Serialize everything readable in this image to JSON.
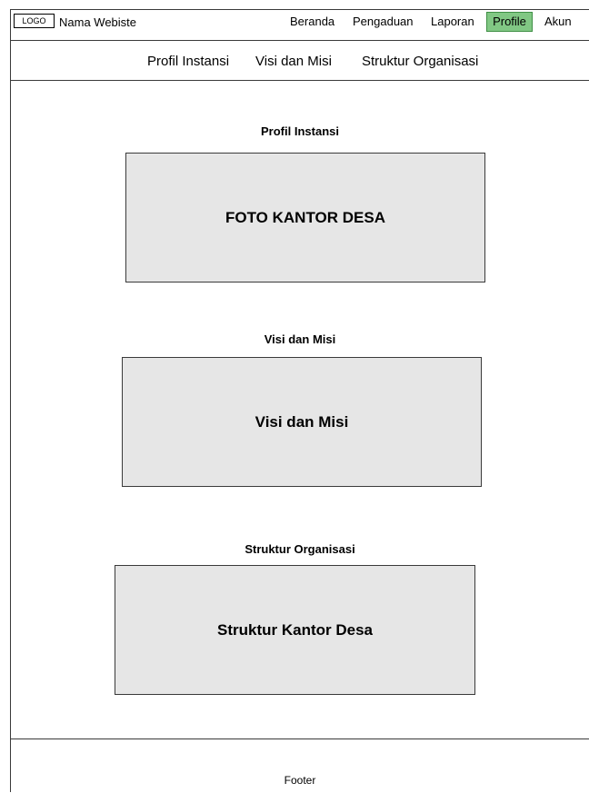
{
  "header": {
    "logo": "LOGO",
    "site_name": "Nama Webiste",
    "nav": {
      "beranda": "Beranda",
      "pengaduan": "Pengaduan",
      "laporan": "Laporan",
      "profile": "Profile",
      "akun": "Akun"
    },
    "active_nav": "Profile",
    "active_color": "#81c784"
  },
  "subnav": {
    "profil": "Profil Instansi",
    "visi": "Visi dan Misi",
    "struktur": "Struktur Organisasi"
  },
  "sections": {
    "profil": {
      "title": "Profil Instansi",
      "placeholder": "FOTO KANTOR DESA"
    },
    "visi": {
      "title": "Visi dan Misi",
      "placeholder": "Visi dan Misi"
    },
    "struktur": {
      "title": "Struktur Organisasi",
      "placeholder": "Struktur Kantor Desa"
    }
  },
  "footer": {
    "text": "Footer"
  }
}
